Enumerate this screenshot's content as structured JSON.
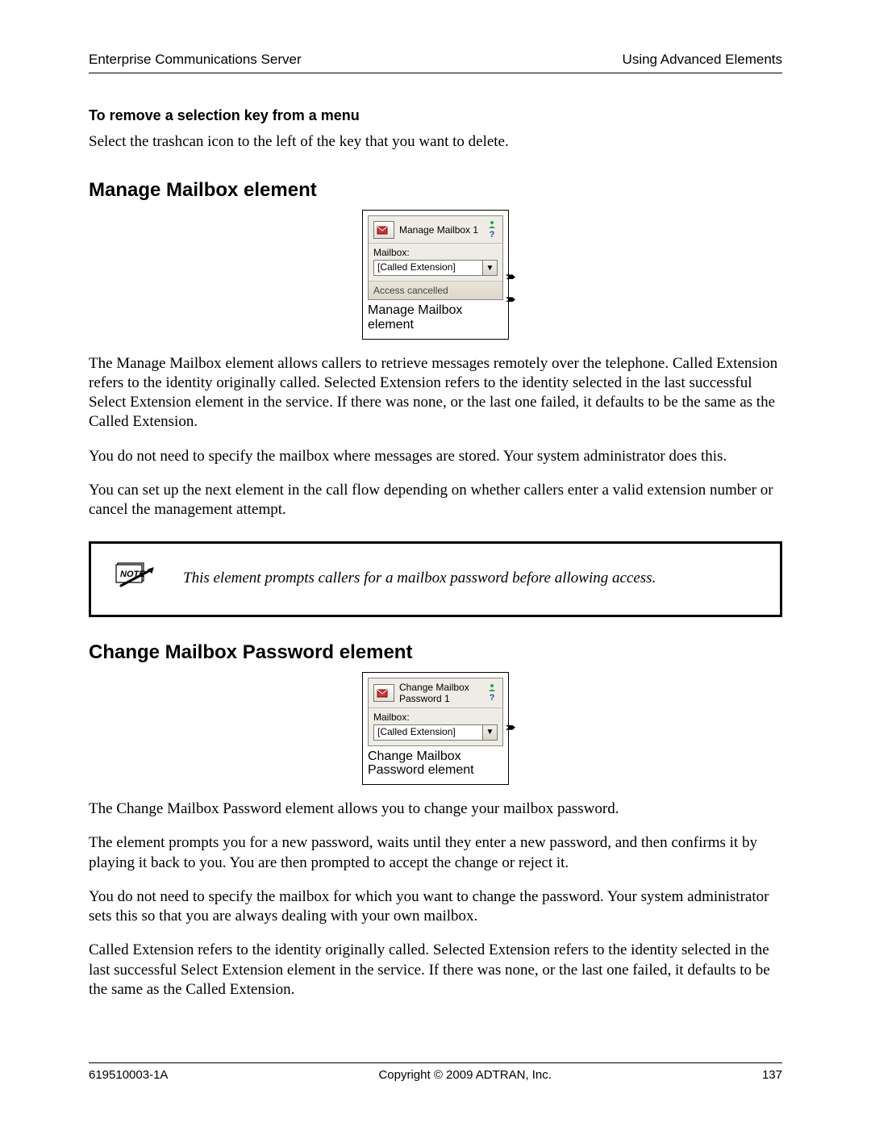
{
  "header": {
    "left": "Enterprise Communications Server",
    "right": "Using Advanced Elements"
  },
  "sec_remove": {
    "title": "To remove a selection key from a menu",
    "p1": "Select the trashcan icon to the left of the key that you want to delete."
  },
  "sec_manage": {
    "h2": "Manage Mailbox element",
    "fig": {
      "title": "Manage Mailbox 1",
      "mailbox_label": "Mailbox:",
      "dropdown_value": "[Called Extension]",
      "stripe": "Access cancelled",
      "caption_l1": "Manage Mailbox",
      "caption_l2": "element"
    },
    "p1": "The Manage Mailbox element allows callers to retrieve messages remotely over the telephone. Called Extension refers to the identity originally called. Selected Extension refers to the identity selected in the last successful Select Extension element in the service. If there was none, or the last one failed, it defaults to be the same as the Called Extension.",
    "p2": "You do not need to specify the mailbox where messages are stored. Your system administrator does this.",
    "p3": "You can set up the next element in the call flow depending on whether callers enter a valid extension number or cancel the management attempt.",
    "note": "This element prompts callers for a mailbox password before allowing access."
  },
  "sec_change": {
    "h2": "Change Mailbox Password element",
    "fig": {
      "title_l1": "Change Mailbox",
      "title_l2": "Password 1",
      "mailbox_label": "Mailbox:",
      "dropdown_value": "[Called Extension]",
      "caption_l1": "Change Mailbox",
      "caption_l2": "Password element"
    },
    "p1": "The Change Mailbox Password element allows you to change your mailbox password.",
    "p2": "The element prompts you for a new password, waits until they enter a new password, and then confirms it by playing it back to you. You are then prompted to accept the change or reject it.",
    "p3": "You do not need to specify the mailbox for which you want to change the password. Your system administrator sets this so that you are always dealing with your own mailbox.",
    "p4": "Called Extension refers to the identity originally called. Selected Extension refers to the identity selected in the last successful Select Extension element in the service. If there was none, or the last one failed, it defaults to be the same as the Called Extension."
  },
  "footer": {
    "left": "619510003-1A",
    "center": "Copyright © 2009 ADTRAN, Inc.",
    "right": "137"
  },
  "glyphs": {
    "help": "?",
    "chev": "▼"
  }
}
